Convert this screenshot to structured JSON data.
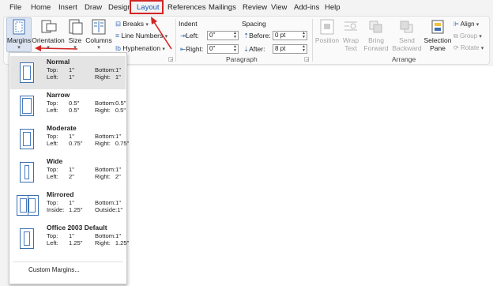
{
  "tabs": [
    "File",
    "Home",
    "Insert",
    "Draw",
    "Design",
    "Layout",
    "References",
    "Mailings",
    "Review",
    "View",
    "Add-ins",
    "Help"
  ],
  "page_setup": {
    "margins": "Margins",
    "orientation": "Orientation",
    "size": "Size",
    "columns": "Columns",
    "breaks": "Breaks",
    "line_numbers": "Line Numbers",
    "hyphenation": "Hyphenation"
  },
  "paragraph": {
    "indent_label": "Indent",
    "spacing_label": "Spacing",
    "left_label": "Left:",
    "left_value": "0\"",
    "right_label": "Right:",
    "right_value": "0\"",
    "before_label": "Before:",
    "before_value": "0 pt",
    "after_label": "After:",
    "after_value": "8 pt",
    "group_label": "Paragraph"
  },
  "arrange": {
    "position": "Position",
    "wrap": "Wrap",
    "text": "Text",
    "bring": "Bring",
    "forward": "Forward",
    "send": "Send",
    "backward": "Backward",
    "selection": "Selection",
    "pane": "Pane",
    "align": "Align",
    "group": "Group",
    "rotate": "Rotate",
    "group_label": "Arrange"
  },
  "margin_options": [
    {
      "name": "Normal",
      "top": "1\"",
      "bottom": "1\"",
      "left": "1\"",
      "right": "1\""
    },
    {
      "name": "Narrow",
      "top": "0.5\"",
      "bottom": "0.5\"",
      "left": "0.5\"",
      "right": "0.5\""
    },
    {
      "name": "Moderate",
      "top": "1\"",
      "bottom": "1\"",
      "left": "0.75\"",
      "right": "0.75\""
    },
    {
      "name": "Wide",
      "top": "1\"",
      "bottom": "1\"",
      "left": "2\"",
      "right": "2\""
    },
    {
      "name": "Mirrored",
      "top": "1\"",
      "bottom": "1\"",
      "inside": "1.25\"",
      "outside": "1\""
    },
    {
      "name": "Office 2003 Default",
      "top": "1\"",
      "bottom": "1\"",
      "left": "1.25\"",
      "right": "1.25\""
    }
  ],
  "labels": {
    "top": "Top:",
    "bottom": "Bottom:",
    "left": "Left:",
    "right": "Right:",
    "inside": "Inside:",
    "outside": "Outside:"
  },
  "custom_margins": "Custom Margins...",
  "colors": {
    "accent": "#185abd",
    "highlight": "#d32424",
    "selected": "#e4e4e4"
  }
}
